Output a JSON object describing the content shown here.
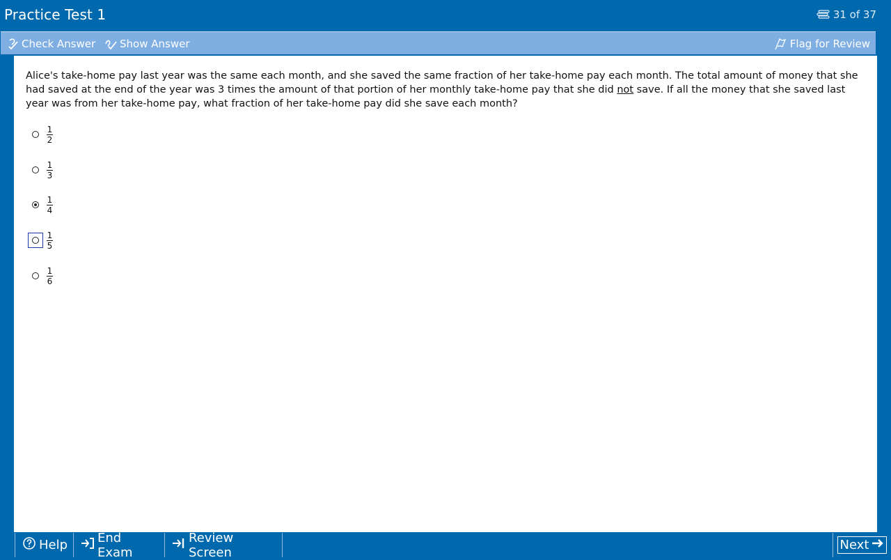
{
  "window": {
    "title": "Practice Test 1",
    "question_counter": "31 of 37"
  },
  "toolbar": {
    "check_answer": "Check Answer",
    "show_answer": "Show Answer",
    "flag_for_review": "Flag for Review"
  },
  "question": {
    "text_before": "Alice's take-home pay last year was the same each month, and she saved the same fraction of her take-home pay each month.  The total amount of money that she had saved at the end of the year was 3 times the amount of that portion of her monthly take-home pay that she did ",
    "underlined": "not",
    "text_after": " save.  If all the money that she saved last year was from her take-home pay, what fraction of her take-home pay did she save each month?"
  },
  "choices": [
    {
      "numerator": "1",
      "denominator": "2",
      "selected": false
    },
    {
      "numerator": "1",
      "denominator": "3",
      "selected": false
    },
    {
      "numerator": "1",
      "denominator": "4",
      "selected": true
    },
    {
      "numerator": "1",
      "denominator": "5",
      "selected": false
    },
    {
      "numerator": "1",
      "denominator": "6",
      "selected": false
    }
  ],
  "bottom": {
    "help": "Help",
    "end_exam": "End Exam",
    "review_screen": "Review Screen",
    "next": "Next"
  },
  "colors": {
    "frame_blue": "#0069ad",
    "toolbar_blue": "#7eaee2",
    "content_bg": "#ffffff"
  }
}
